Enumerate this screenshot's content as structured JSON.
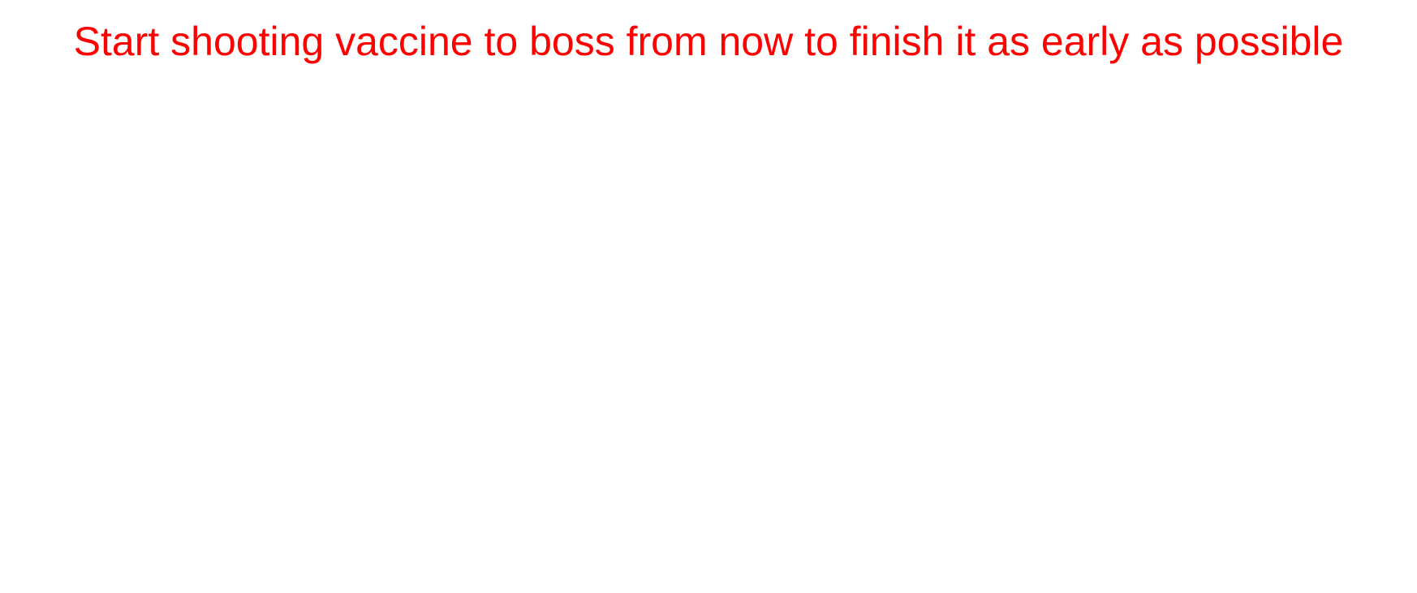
{
  "hint": {
    "text": "Start shooting vaccine to boss from now to finish it as early as possible",
    "color": "#FF0000"
  },
  "background_color": "#FFFFFF"
}
